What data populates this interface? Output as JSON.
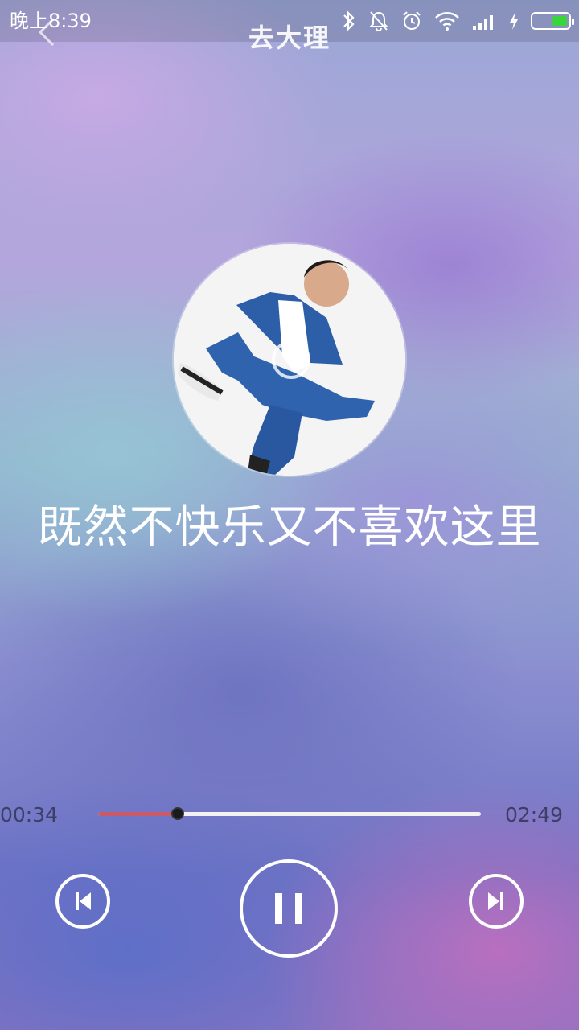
{
  "status_bar": {
    "time": "晚上8:39",
    "icons": [
      "bluetooth-icon",
      "mute-icon",
      "alarm-icon",
      "wifi-icon",
      "signal-icon",
      "charging-icon",
      "battery-icon"
    ],
    "battery_level": 0.45,
    "battery_color": "#39d63b"
  },
  "header": {
    "title": "去大理",
    "back_icon": "back-arrow-icon"
  },
  "album": {
    "description_icon": "album-art"
  },
  "lyrics": {
    "current_line": "既然不快乐又不喜欢这里"
  },
  "player": {
    "current_time": "00:34",
    "total_time": "02:49",
    "progress": 0.207,
    "progress_color": "#c95a6a",
    "controls": {
      "prev": "previous-track-icon",
      "play_pause": "pause-icon",
      "next": "next-track-icon"
    }
  }
}
